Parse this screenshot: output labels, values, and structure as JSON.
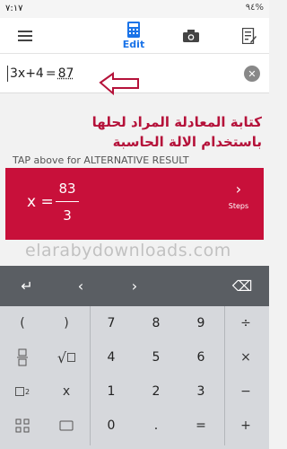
{
  "status_bar": {
    "time": "٧:١٧",
    "signal": "٩٤%"
  },
  "app_bar": {
    "edit_label": "Edit"
  },
  "equation": {
    "lhs": "3x+4",
    "equals": "=",
    "rhs": "87"
  },
  "annotation": {
    "line1": "كتابة المعادلة المراد لحلها",
    "line2": "باستخدام الالة الحاسبة"
  },
  "hint": "TAP above for ALTERNATIVE RESULT",
  "result": {
    "variable": "x =",
    "numerator": "83",
    "denominator": "3",
    "steps_label": "Steps"
  },
  "watermark": "elarabydownloads.com",
  "keyboard": {
    "top_row": [
      "↵",
      "‹",
      "›",
      "⌫"
    ],
    "rows": [
      [
        "(",
        ")",
        "7",
        "8",
        "9",
        "÷"
      ],
      [
        "",
        "√",
        "4",
        "5",
        "6",
        "×"
      ],
      [
        "",
        "x",
        "1",
        "2",
        "3",
        "−"
      ],
      [
        "",
        "",
        "0",
        ".",
        "=",
        "+"
      ]
    ]
  },
  "colors": {
    "accent": "#1a73e8",
    "result_bg": "#c8103a",
    "annotation": "#b5123a",
    "keyboard_top": "#5a5e63"
  }
}
